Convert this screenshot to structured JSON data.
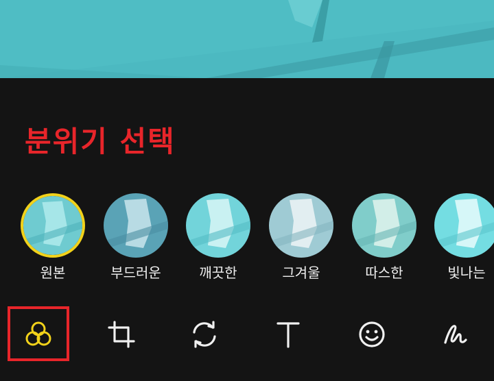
{
  "annotation": {
    "text": "분위기 선택",
    "color": "#e8252a"
  },
  "filters": [
    {
      "label": "원본",
      "tint": "#7fd6d8",
      "selected": true
    },
    {
      "label": "부드러운",
      "tint": "#5aa7b9",
      "selected": false
    },
    {
      "label": "깨끗한",
      "tint": "#7cd9df",
      "selected": false
    },
    {
      "label": "그겨울",
      "tint": "#a6d4dc",
      "selected": false
    },
    {
      "label": "따스한",
      "tint": "#86d1cf",
      "selected": false
    },
    {
      "label": "빛나는",
      "tint": "#7fe0e4",
      "selected": false
    }
  ],
  "toolbar": {
    "tools": [
      {
        "icon": "filter-circles-icon",
        "active": true
      },
      {
        "icon": "crop-icon",
        "active": false
      },
      {
        "icon": "rotate-icon",
        "active": false
      },
      {
        "icon": "text-icon",
        "active": false
      },
      {
        "icon": "sticker-smiley-icon",
        "active": false
      },
      {
        "icon": "draw-scribble-icon",
        "active": false
      }
    ]
  },
  "colors": {
    "accent_selected": "#f2d21a",
    "annotation_red": "#e8252a",
    "background": "#141414"
  }
}
